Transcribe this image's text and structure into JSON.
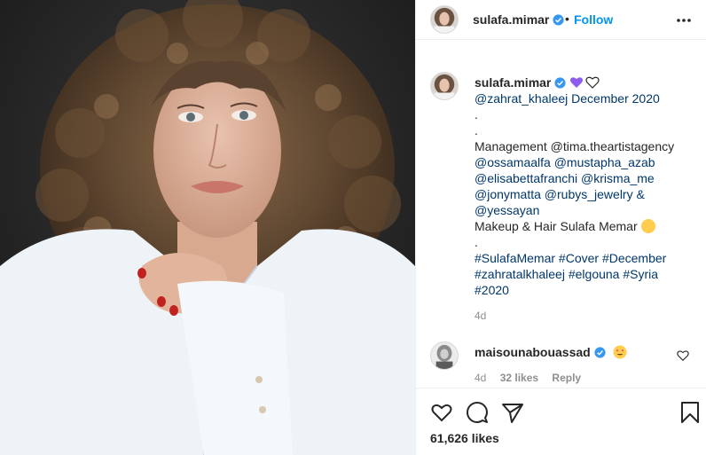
{
  "header": {
    "username": "sulafa.mimar",
    "separator": "•",
    "follow_label": "Follow"
  },
  "caption": {
    "username": "sulafa.mimar",
    "lines": [
      "@zahrat_khaleej December 2020",
      ".",
      ".",
      "Management @tima.theartistagency",
      "@ossamaalfa @mustapha_azab",
      "@elisabettafranchi @krisma_me",
      "@jonymatta @rubys_jewelry &",
      "@yessayan",
      "Makeup & Hair Sulafa Memar",
      ".",
      "#SulafaMemar #Cover #December",
      "#zahratalkhaleej #elgouna #Syria",
      "#2020"
    ],
    "time": "4d"
  },
  "comment": {
    "username": "maisounabouassad",
    "time": "4d",
    "likes": "32 likes",
    "reply": "Reply"
  },
  "post": {
    "likes": "61,626 likes"
  },
  "icons": {
    "more": "more-dots-icon",
    "like": "heart-icon",
    "comment": "comment-icon",
    "share": "share-icon",
    "save": "bookmark-icon",
    "verified": "verified-badge-icon"
  },
  "colors": {
    "link": "#00376b",
    "follow": "#0095f6",
    "verified": "#3897f0",
    "muted": "#8e8e8e"
  }
}
